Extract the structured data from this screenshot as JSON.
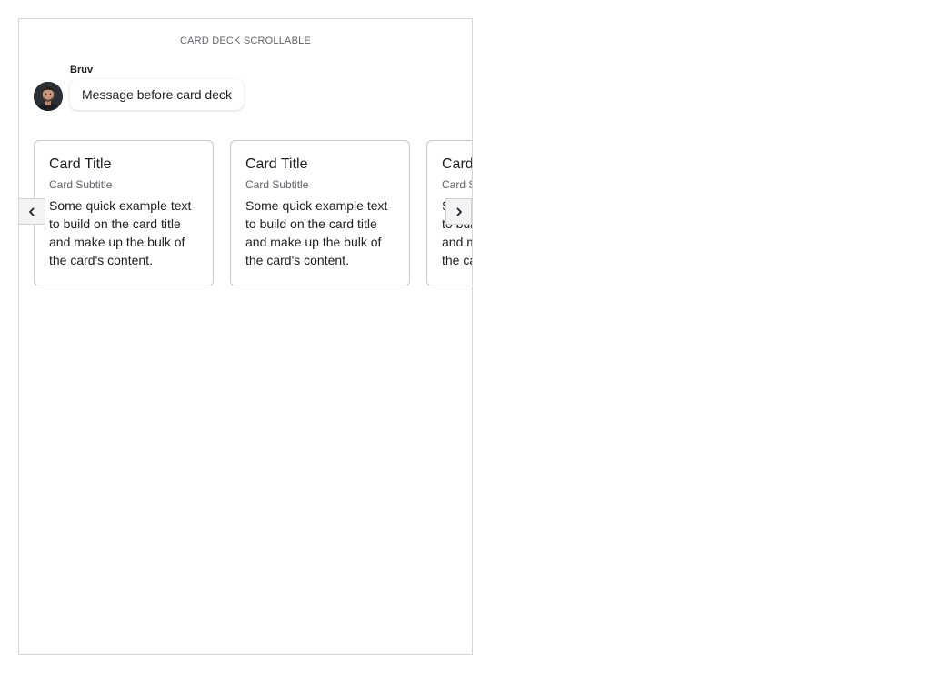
{
  "header": {
    "title": "CARD DECK SCROLLABLE"
  },
  "message": {
    "sender": "Bruv",
    "text": "Message before card deck",
    "avatar_icon": "user-avatar-photo"
  },
  "card_deck": {
    "cards": [
      {
        "title": "Card Title",
        "subtitle": "Card Subtitle",
        "text": "Some quick example text to build on the card title and make up the bulk of the card's content."
      },
      {
        "title": "Card Title",
        "subtitle": "Card Subtitle",
        "text": "Some quick example text to build on the card title and make up the bulk of the card's content."
      },
      {
        "title": "Card Title",
        "subtitle": "Card Subtitle",
        "text": "Some quick example text to build on the card title and make up the bulk of the card's content."
      }
    ],
    "scroll_left_icon": "chevron-left-icon",
    "scroll_right_icon": "chevron-right-icon"
  },
  "colors": {
    "border": "#d6d6d6",
    "card_border": "#c8c8c8",
    "muted_text": "#5f6368",
    "button_bg": "#f1f3f4"
  }
}
